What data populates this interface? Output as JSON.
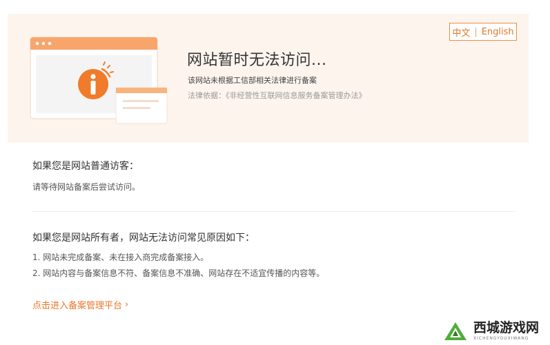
{
  "header": {
    "title": "网站暂时无法访问...",
    "subtitle": "该网站未根据工信部相关法律进行备案",
    "basis": "法律依据：《非经营性互联网信息服务备案管理办法》"
  },
  "lang_switch": {
    "zh": "中文",
    "separator": "|",
    "en": "English"
  },
  "visitor": {
    "heading": "如果您是网站普通访客：",
    "text": "请等待网站备案后尝试访问。"
  },
  "owner": {
    "heading": "如果您是网站所有者，网站无法访问常见原因如下：",
    "reasons": [
      "1. 网站未完成备案、未在接入商完成备案接入。",
      "2. 网站内容与备案信息不符、备案信息不准确、网站存在不适宜传播的内容等。"
    ]
  },
  "link": {
    "label": "点击进入备案管理平台",
    "arrow": "›"
  },
  "watermark": {
    "text": "西城游戏网",
    "sub": "XICHENGYOUXIWANG"
  },
  "colors": {
    "accent": "#e8762b",
    "banner_bg": "#fdf4ee"
  },
  "icons": [
    "info-icon",
    "chevron-right-icon",
    "leaf-logo-icon"
  ]
}
